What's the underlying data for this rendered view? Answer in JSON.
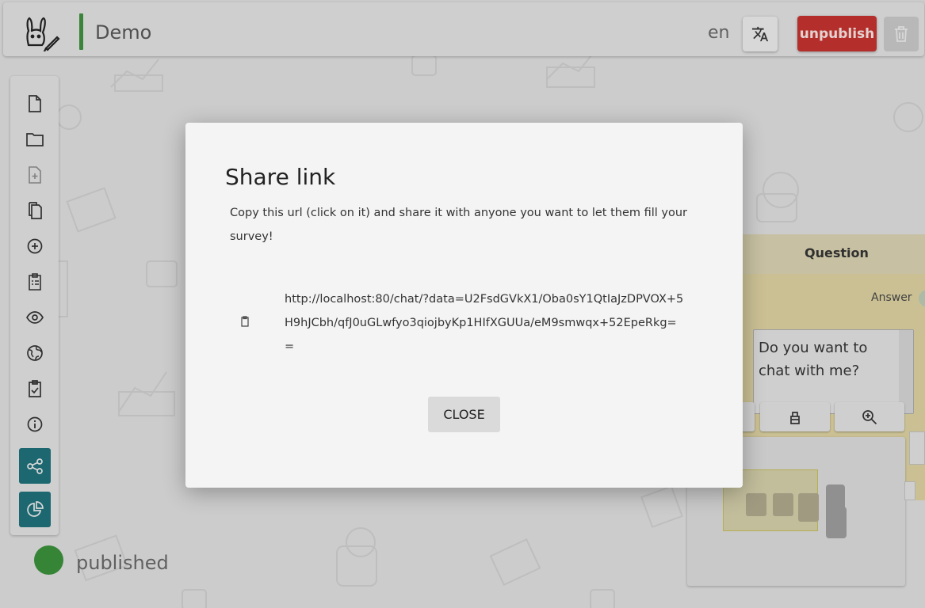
{
  "header": {
    "title": "Demo",
    "language": "en",
    "unpublish_label": "unpublish"
  },
  "sidebar": {
    "items": [
      {
        "icon": "new-file-icon"
      },
      {
        "icon": "folder-icon"
      },
      {
        "icon": "add-file-icon"
      },
      {
        "icon": "copy-icon"
      },
      {
        "icon": "plus-circle-icon"
      },
      {
        "icon": "clipboard-list-icon"
      },
      {
        "icon": "eye-icon"
      },
      {
        "icon": "globe-icon"
      },
      {
        "icon": "clipboard-check-icon"
      },
      {
        "icon": "info-icon"
      },
      {
        "icon": "share-icon"
      },
      {
        "icon": "pie-chart-icon"
      }
    ],
    "status": "published",
    "status_color": "#3a8e3a"
  },
  "editor": {
    "column_header": "Question",
    "answer_label": "Answer",
    "question_text": "Do you want to chat with me?"
  },
  "dialog": {
    "title": "Share link",
    "description": "Copy this url (click on it) and share it with anyone you want to let them fill your survey!",
    "url": "http://localhost:80/chat/?data=U2FsdGVkX1/Oba0sY1QtIaJzDPVOX+5H9hJCbh/qfJ0uGLwfyo3qiojbyKp1HIfXGUUa/eM9smwqx+52EpeRkg==",
    "close_label": "CLOSE"
  },
  "colors": {
    "accent": "#1e6e78",
    "danger": "#c0322e",
    "published": "#3a8e3a"
  }
}
